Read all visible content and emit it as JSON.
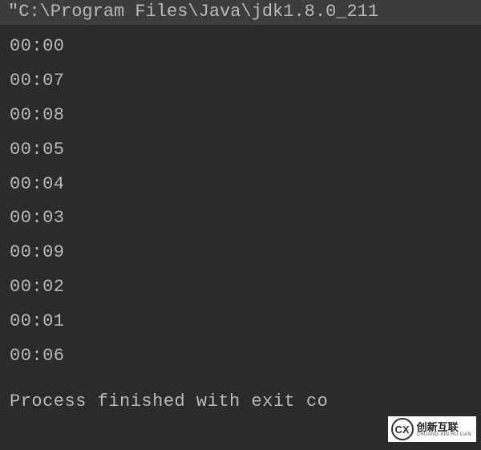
{
  "console": {
    "path": "\"C:\\Program Files\\Java\\jdk1.8.0_211",
    "output": [
      "00:00",
      "00:07",
      "00:08",
      "00:05",
      "00:04",
      "00:03",
      "00:09",
      "00:02",
      "00:01",
      "00:06"
    ],
    "status": "Process finished with exit co"
  },
  "watermark": {
    "logo_text": "CX",
    "cn": "创新互联",
    "en": "CHUANG XIN HU LIAN"
  }
}
